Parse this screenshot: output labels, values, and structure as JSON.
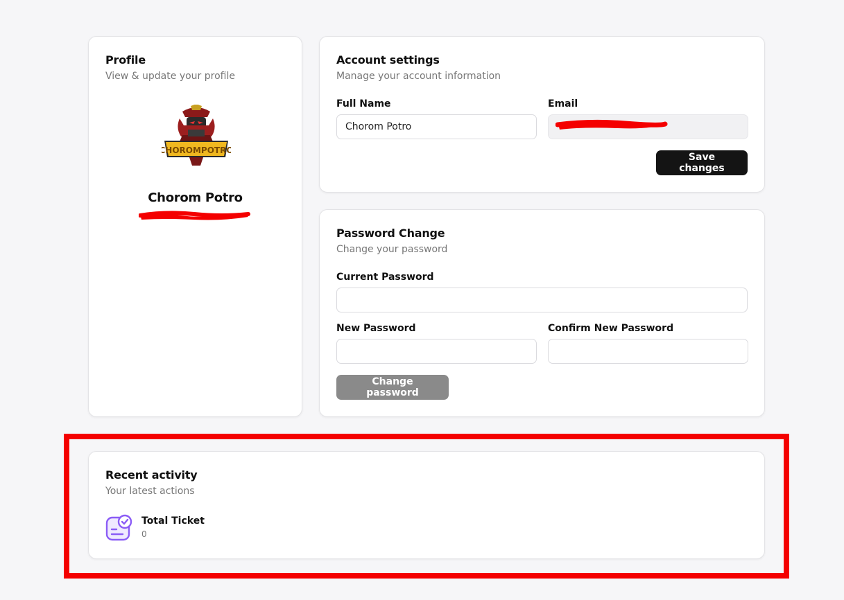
{
  "profile": {
    "title": "Profile",
    "subtitle": "View & update your profile",
    "avatar_text": "CHOROMPOTRO",
    "name": "Chorom Potro",
    "email": ""
  },
  "account": {
    "title": "Account settings",
    "subtitle": "Manage your account information",
    "full_name_label": "Full Name",
    "full_name_value": "Chorom Potro",
    "email_label": "Email",
    "email_value": "",
    "save_label": "Save changes"
  },
  "password": {
    "title": "Password Change",
    "subtitle": "Change your password",
    "current_label": "Current Password",
    "new_label": "New Password",
    "confirm_label": "Confirm New Password",
    "change_label": "Change password"
  },
  "activity": {
    "title": "Recent activity",
    "subtitle": "Your latest actions",
    "items": [
      {
        "label": "Total Ticket",
        "value": "0",
        "icon": "ticket-check-icon"
      }
    ]
  },
  "colors": {
    "background": "#f6f6f8",
    "primary_button": "#141414",
    "disabled_button": "#8a8a8a",
    "accent_icon": "#8b5cf6",
    "annotation_red": "#f40000"
  }
}
